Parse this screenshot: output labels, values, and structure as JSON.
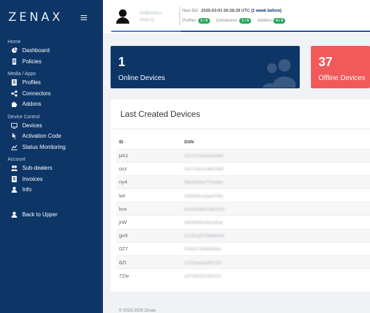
{
  "brand": "ZENAX",
  "sidebar": {
    "sections": [
      {
        "title": "Home",
        "items": [
          {
            "label": "Dashboard",
            "icon": "dashboard-icon"
          },
          {
            "label": "Policies",
            "icon": "document-icon"
          }
        ]
      },
      {
        "title": "Media / Apps",
        "items": [
          {
            "label": "Profiles",
            "icon": "profile-icon"
          },
          {
            "label": "Connectors",
            "icon": "share-icon"
          },
          {
            "label": "Addons",
            "icon": "puzzle-icon"
          }
        ]
      },
      {
        "title": "Device Control",
        "items": [
          {
            "label": "Devices",
            "icon": "devices-icon"
          },
          {
            "label": "Activation Code",
            "icon": "cursor-icon"
          },
          {
            "label": "Status Monitoring",
            "icon": "chart-icon"
          }
        ]
      },
      {
        "title": "Account",
        "items": [
          {
            "label": "Sub-dealers",
            "icon": "users-icon"
          },
          {
            "label": "Invoices",
            "icon": "invoice-icon"
          },
          {
            "label": "Info",
            "icon": "user-icon"
          }
        ]
      }
    ],
    "back": {
      "label": "Back to Upper",
      "icon": "user-icon"
    }
  },
  "header": {
    "account_email": "test@zenax.io",
    "account_role": "Dealer (i)",
    "next_bill_label": "Next Bill :",
    "next_bill_date": "2025-03-01 00:28:29 UTC",
    "next_bill_relative": "(1 week before)",
    "profiles_label": "Profiles",
    "profiles_value": "1 / 5",
    "connectors_label": "Connectors",
    "connectors_value": "1 / 5",
    "addons_label": "Addons",
    "addons_value": "4 / 6"
  },
  "cards": {
    "online": {
      "count": "1",
      "label": "Online Devices"
    },
    "offline": {
      "count": "37",
      "label": "Offline Devices"
    }
  },
  "devices": {
    "title": "Last Created Devices",
    "columns": [
      "ID",
      "DSN"
    ],
    "rows": [
      {
        "id": "pA1",
        "dsn": "321371ec91bbefbd"
      },
      {
        "id": "ozz",
        "dsn": "c527c6cce4bb1968"
      },
      {
        "id": "ny4",
        "dsn": "f98c0004e77ee9de"
      },
      {
        "id": "lwl",
        "dsn": "93d4b9ce33a47f9d"
      },
      {
        "id": "kvx",
        "dsn": "e0c919d0e79d1229"
      },
      {
        "id": "jrW",
        "dsn": "b60f9666c5b1c6aa"
      },
      {
        "id": "go9",
        "dsn": "5cc91a2079b6b4dd"
      },
      {
        "id": "0Z7",
        "dsn": "f04937c0d4ffe59a"
      },
      {
        "id": "8ZI",
        "dsn": "10793ace035f7f24"
      },
      {
        "id": "7Zw",
        "dsn": "e0736533c35522f"
      }
    ]
  },
  "footer": "© 2023-2025 Zenax"
}
